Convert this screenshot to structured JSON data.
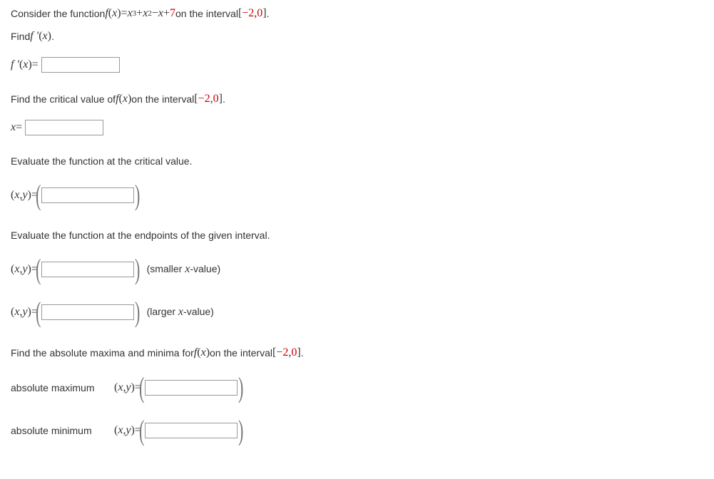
{
  "q1": {
    "prefix": "Consider the function ",
    "fn": "f",
    "var": "x",
    "eq": " = ",
    "term1_var": "x",
    "term1_exp": "3",
    "plus1": " + ",
    "term2_var": "x",
    "term2_exp": "2",
    "minus": " − ",
    "term3_var": "x",
    "plus2": " + ",
    "const": "7",
    "on": " on the interval ",
    "lbrack": "[",
    "a": "−2",
    "comma": ", ",
    "b": "0",
    "rbrack": "]",
    "period": "."
  },
  "q2": {
    "text": "Find ",
    "fn": "f ′",
    "var": "x",
    "period": "."
  },
  "q3": {
    "label_fn": "f ′",
    "label_var": "x",
    "eq": " = "
  },
  "q4": {
    "prefix": "Find the critical value of ",
    "fn": "f",
    "var": "x",
    "mid": " on the interval ",
    "lbrack": "[",
    "a": "−2",
    "comma": ", ",
    "b": "0",
    "rbrack": "]",
    "period": "."
  },
  "q5": {
    "label_var": "x",
    "eq": " = "
  },
  "q6": {
    "text": "Evaluate the function at the critical value."
  },
  "xy": {
    "open": "(",
    "x": "x",
    "comma": ", ",
    "y": "y",
    "close": ")",
    "eq": "  =  "
  },
  "q8": {
    "text": "Evaluate the function at the endpoints of the given interval."
  },
  "q9": {
    "desc": "(smaller ",
    "var": "x",
    "suffix": "-value)"
  },
  "q10": {
    "desc": "(larger ",
    "var": "x",
    "suffix": "-value)"
  },
  "q11": {
    "prefix": "Find the absolute maxima and minima for ",
    "fn": "f",
    "var": "x",
    "mid": " on the interval ",
    "lbrack": "[",
    "a": "−2",
    "comma": ", ",
    "b": "0",
    "rbrack": "]",
    "period": "."
  },
  "q12": {
    "label": "absolute maximum"
  },
  "q13": {
    "label": "absolute minimum"
  }
}
